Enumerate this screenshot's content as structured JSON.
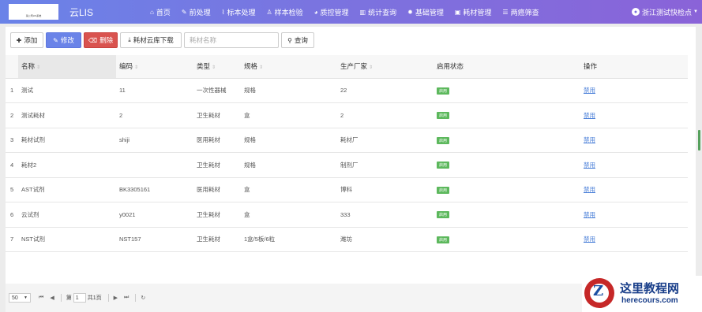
{
  "topbar": {
    "logo_text": "某公司LIS系统",
    "app_title": "云LIS",
    "nav": [
      {
        "icon": "home-icon",
        "glyph": "⌂",
        "label": "首页"
      },
      {
        "icon": "wrench-icon",
        "glyph": "✎",
        "label": "前处理"
      },
      {
        "icon": "tag-icon",
        "glyph": "⌇",
        "label": "标本处理"
      },
      {
        "icon": "flask-icon",
        "glyph": "♙",
        "label": "样本检验"
      },
      {
        "icon": "chart-pie-icon",
        "glyph": "◕",
        "label": "质控管理"
      },
      {
        "icon": "bar-chart-icon",
        "glyph": "▥",
        "label": "统计查询"
      },
      {
        "icon": "gear-icon",
        "glyph": "✹",
        "label": "基础管理"
      },
      {
        "icon": "briefcase-icon",
        "glyph": "▣",
        "label": "耗材管理"
      },
      {
        "icon": "list-icon",
        "glyph": "☰",
        "label": "两癌筛查"
      }
    ],
    "user": "浙江测试快检点"
  },
  "toolbar": {
    "add": "添加",
    "edit": "修改",
    "delete": "删除",
    "download": "耗材云库下载",
    "search_placeholder": "耗材名称",
    "query": "查询"
  },
  "table": {
    "columns": [
      "名称",
      "编码",
      "类型",
      "规格",
      "生产厂家",
      "启用状态",
      "操作"
    ],
    "rows": [
      {
        "idx": "1",
        "name": "测试",
        "code": "11",
        "type": "一次性器械",
        "spec": "规格",
        "maker": "22",
        "status": "启用",
        "action": "禁用"
      },
      {
        "idx": "2",
        "name": "测试耗材",
        "code": "2",
        "type": "卫生耗材",
        "spec": "盒",
        "maker": "2",
        "status": "启用",
        "action": "禁用"
      },
      {
        "idx": "3",
        "name": "耗材试剂",
        "code": "shiji",
        "type": "医用耗材",
        "spec": "规格",
        "maker": "耗材厂",
        "status": "启用",
        "action": "禁用"
      },
      {
        "idx": "4",
        "name": "耗材2",
        "code": "",
        "type": "卫生耗材",
        "spec": "规格",
        "maker": "制剂厂",
        "status": "启用",
        "action": "禁用"
      },
      {
        "idx": "5",
        "name": "AST试剂",
        "code": "BK3305161",
        "type": "医用耗材",
        "spec": "盒",
        "maker": "博科",
        "status": "启用",
        "action": "禁用"
      },
      {
        "idx": "6",
        "name": "云试剂",
        "code": "y0021",
        "type": "卫生耗材",
        "spec": "盒",
        "maker": "333",
        "status": "启用",
        "action": "禁用"
      },
      {
        "idx": "7",
        "name": "NST试剂",
        "code": "NST157",
        "type": "卫生耗材",
        "spec": "1盒/5板/6粒",
        "maker": "潍坊",
        "status": "启用",
        "action": "禁用"
      }
    ]
  },
  "pager": {
    "page_size": "50",
    "page_prefix": "第",
    "page_value": "1",
    "page_suffix": "共1页"
  },
  "watermark": {
    "title": "这里教程网",
    "url": "herecours.com"
  },
  "colors": {
    "navbar_start": "#6a83e8",
    "navbar_end": "#8a63d8",
    "edit_button": "#6a83e8",
    "delete_button": "#d9534f",
    "status_badge": "#5cb85c",
    "link": "#4a7fd8"
  }
}
